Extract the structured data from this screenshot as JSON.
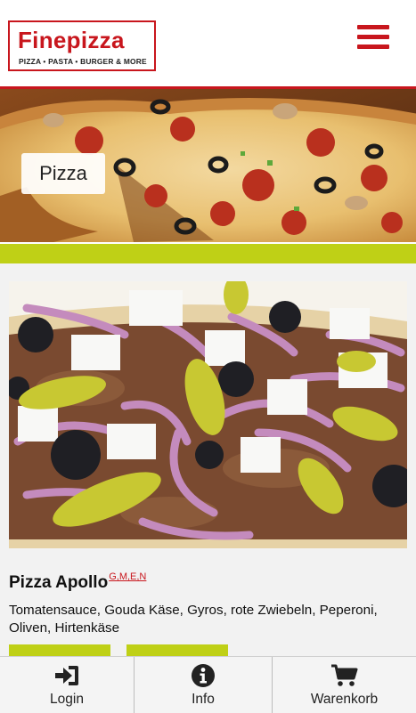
{
  "header": {
    "logo_title": "Finepizza",
    "logo_subtitle": "PIZZA • PASTA • BURGER & MORE",
    "menu_icon": "hamburger-menu-icon",
    "accent_color": "#c8161d"
  },
  "banner": {
    "category_label": "Pizza"
  },
  "product": {
    "name": "Pizza Apollo",
    "allergens": "G,M,E,N",
    "description": "Tomatensauce, Gouda Käse, Gyros, rote Zwiebeln, Peperoni, Oliven, Hirtenkäse",
    "button_color": "#bfd016"
  },
  "bottom_nav": {
    "items": [
      {
        "label": "Login",
        "icon": "sign-in-icon"
      },
      {
        "label": "Info",
        "icon": "info-icon"
      },
      {
        "label": "Warenkorb",
        "icon": "shopping-cart-icon"
      }
    ]
  }
}
